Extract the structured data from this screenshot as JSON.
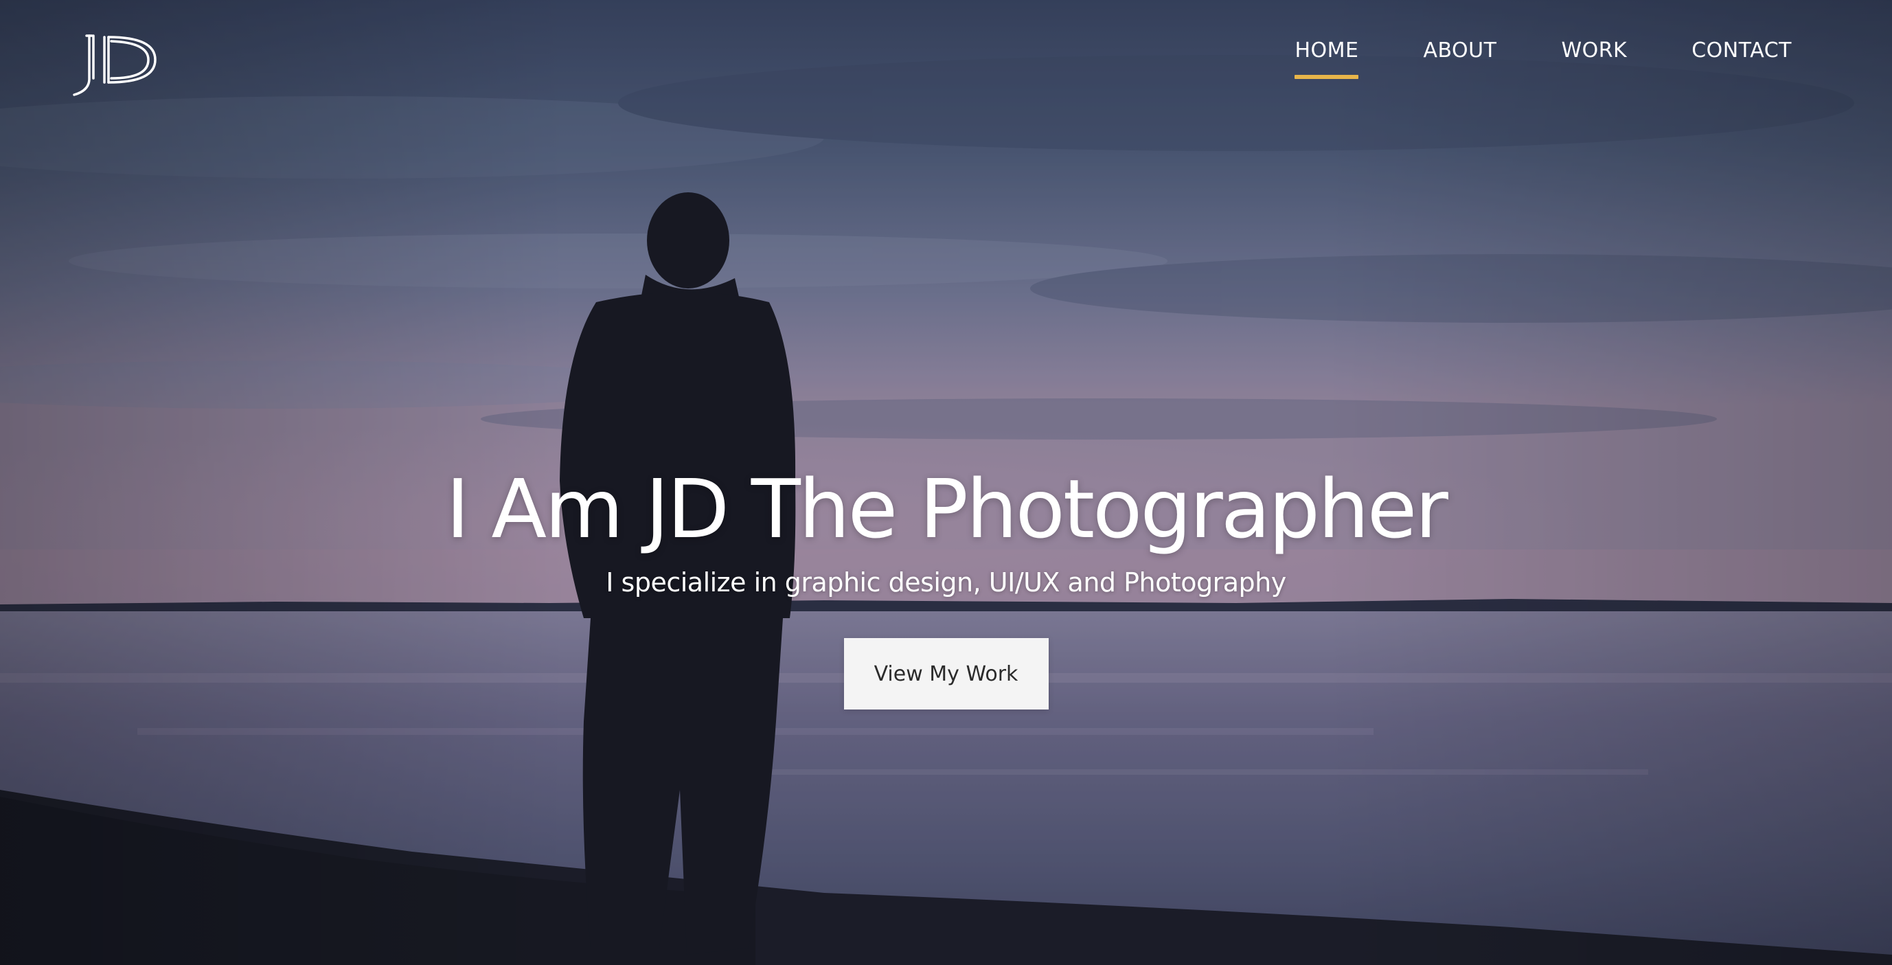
{
  "brand": {
    "logo_icon": "jd-monogram-logo"
  },
  "nav": {
    "items": [
      {
        "label": "HOME",
        "active": true
      },
      {
        "label": "ABOUT",
        "active": false
      },
      {
        "label": "WORK",
        "active": false
      },
      {
        "label": "CONTACT",
        "active": false
      }
    ],
    "accent_color": "#e8b54a"
  },
  "hero": {
    "title": "I Am JD The Photographer",
    "subtitle": "I specialize in graphic design, UI/UX and Photography",
    "cta_label": "View My Work",
    "background_icon": "silhouette-lake-photo"
  }
}
